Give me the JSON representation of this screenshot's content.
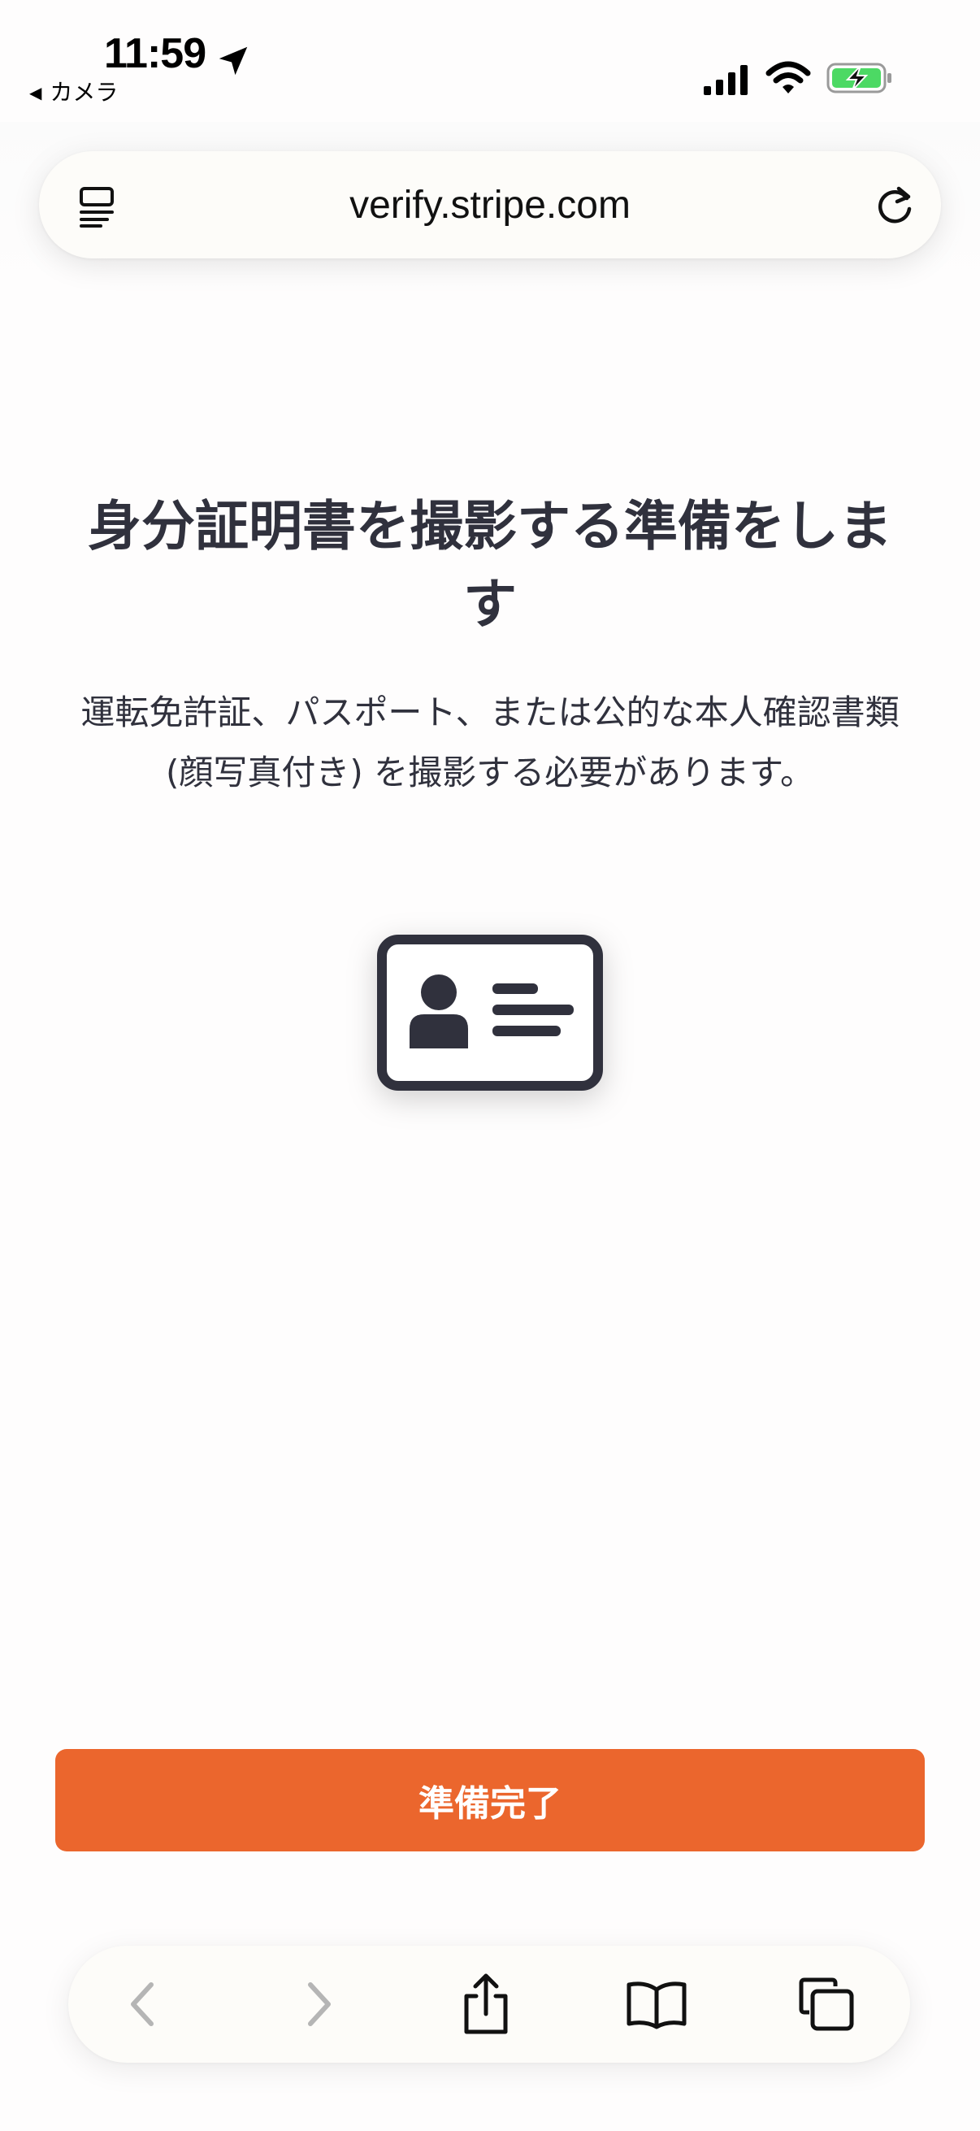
{
  "status_bar": {
    "time": "11:59",
    "back_app_label": "カメラ",
    "icons": [
      "location-arrow-icon",
      "cellular-signal-icon",
      "wifi-icon",
      "battery-charging-icon"
    ],
    "battery_color": "#4cd964"
  },
  "address_bar": {
    "url": "verify.stripe.com",
    "icons": [
      "reader-mode-icon",
      "reload-icon"
    ]
  },
  "main": {
    "heading": "身分証明書を撮影する準備をします",
    "description": "運転免許証、パスポート、または公的な本人確認書類 (顔写真付き) を撮影する必要があります。",
    "illustration": "id-card-icon"
  },
  "primary_button": {
    "label": "準備完了",
    "color": "#eb662d"
  },
  "toolbar": {
    "items": [
      "back-icon",
      "forward-icon",
      "share-icon",
      "bookmarks-icon",
      "tabs-icon"
    ]
  }
}
